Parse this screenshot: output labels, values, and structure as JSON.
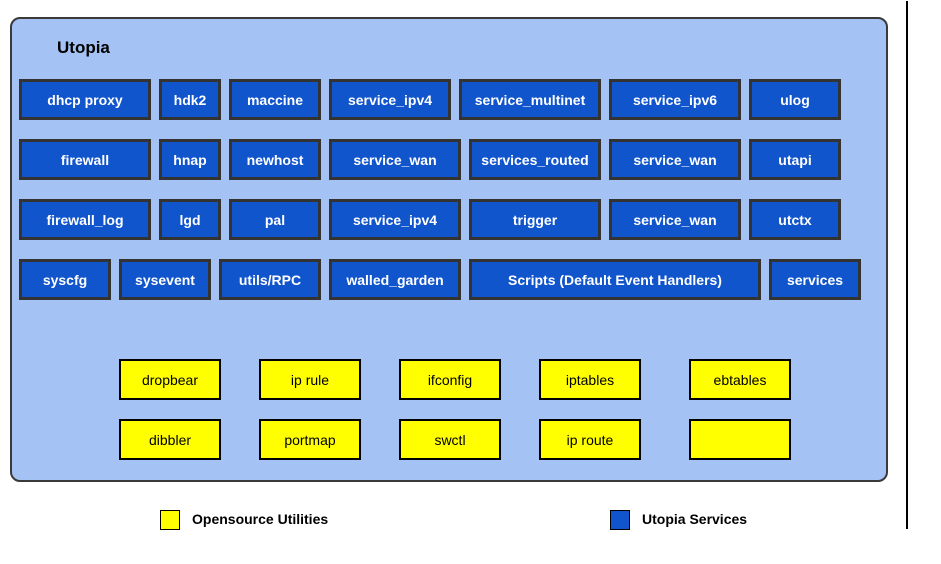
{
  "diagram": {
    "title": "Utopia",
    "colors": {
      "container_fill": "#a4c2f4",
      "service_fill": "#1155cc",
      "utility_fill": "#ffff00"
    },
    "service_rows": [
      [
        "dhcp proxy",
        "hdk2",
        "maccine",
        "service_ipv4",
        "service_multinet",
        "service_ipv6",
        "ulog"
      ],
      [
        "firewall",
        "hnap",
        "newhost",
        "service_wan",
        "services_routed",
        "service_wan",
        "utapi"
      ],
      [
        "firewall_log",
        "lgd",
        "pal",
        "service_ipv4",
        "trigger",
        "service_wan",
        "utctx"
      ],
      [
        "syscfg",
        "sysevent",
        "utils/RPC",
        "walled_garden",
        "Scripts (Default Event Handlers)",
        "services"
      ]
    ],
    "utility_rows": [
      [
        "dropbear",
        "ip rule",
        "ifconfig",
        "iptables",
        "ebtables"
      ],
      [
        "dibbler",
        "portmap",
        "swctl",
        "ip route",
        ""
      ]
    ]
  },
  "legend": {
    "opensource": "Opensource Utilities",
    "utopia": "Utopia Services"
  }
}
